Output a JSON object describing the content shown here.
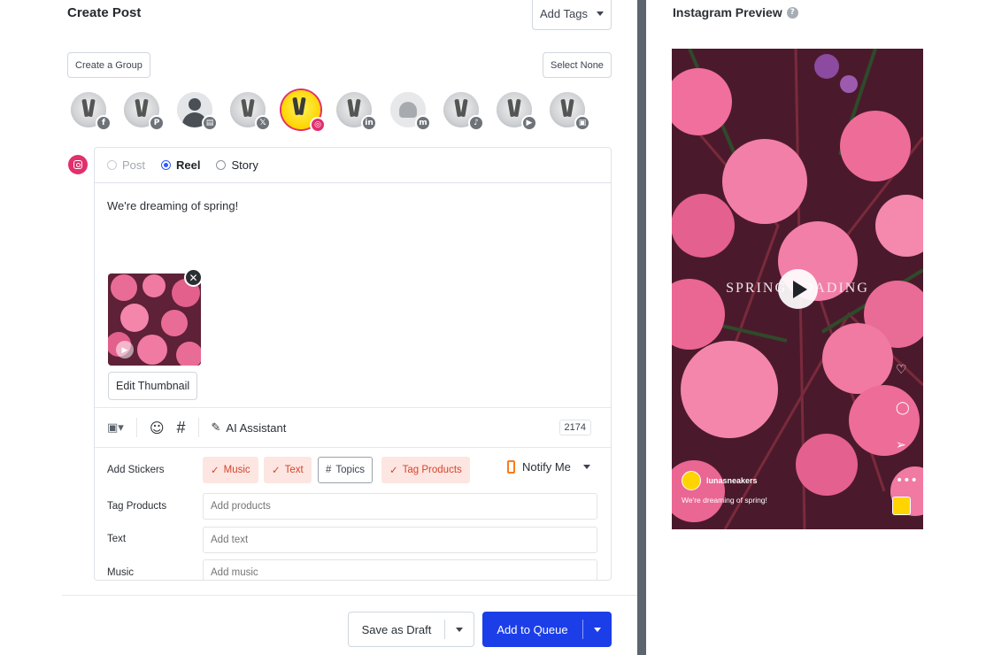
{
  "header": {
    "title": "Create Post",
    "add_tags_label": "Add Tags"
  },
  "group": {
    "create_label": "Create a Group",
    "select_none_label": "Select None"
  },
  "channels": [
    {
      "network": "facebook",
      "badge": "f",
      "icon": "facebook-icon"
    },
    {
      "network": "pinterest",
      "badge": "P",
      "icon": "pinterest-icon"
    },
    {
      "network": "google-business",
      "badge": "▤",
      "icon": "google-business-icon"
    },
    {
      "network": "x",
      "badge": "𝕏",
      "icon": "x-icon"
    },
    {
      "network": "instagram",
      "badge": "◎",
      "icon": "instagram-icon",
      "selected": true
    },
    {
      "network": "linkedin",
      "badge": "in",
      "icon": "linkedin-icon"
    },
    {
      "network": "mastodon",
      "badge": "m",
      "icon": "mastodon-icon"
    },
    {
      "network": "tiktok",
      "badge": "♪",
      "icon": "tiktok-icon"
    },
    {
      "network": "youtube",
      "badge": "▶",
      "icon": "youtube-icon"
    },
    {
      "network": "start-page",
      "badge": "▣",
      "icon": "start-page-icon"
    }
  ],
  "post_types": {
    "post": "Post",
    "reel": "Reel",
    "story": "Story",
    "selected": "Reel"
  },
  "composer": {
    "caption": "We're dreaming of spring!",
    "edit_thumbnail_label": "Edit Thumbnail",
    "ai_assistant_label": "AI Assistant",
    "char_count": "2174"
  },
  "stickers": {
    "label": "Add Stickers",
    "items": [
      {
        "label": "Music",
        "checked": true
      },
      {
        "label": "Text",
        "checked": true
      },
      {
        "label": "Topics",
        "checked": false
      },
      {
        "label": "Tag Products",
        "checked": true
      }
    ],
    "notify_label": "Notify Me"
  },
  "fields": {
    "tag_products": {
      "label": "Tag Products",
      "placeholder": "Add products"
    },
    "text": {
      "label": "Text",
      "placeholder": "Add text"
    },
    "music": {
      "label": "Music",
      "placeholder": "Add music"
    }
  },
  "footer": {
    "save_draft_label": "Save as Draft",
    "add_queue_label": "Add to Queue"
  },
  "preview": {
    "title": "Instagram Preview",
    "overlay_text": "SPRING LOADING",
    "username": "lunasneakers",
    "caption": "We're dreaming of spring!"
  },
  "colors": {
    "accent": "#1b3ee8",
    "instagram": "#e1306c",
    "sticker_bg": "#fde6e1",
    "sticker_fg": "#d3452f"
  }
}
